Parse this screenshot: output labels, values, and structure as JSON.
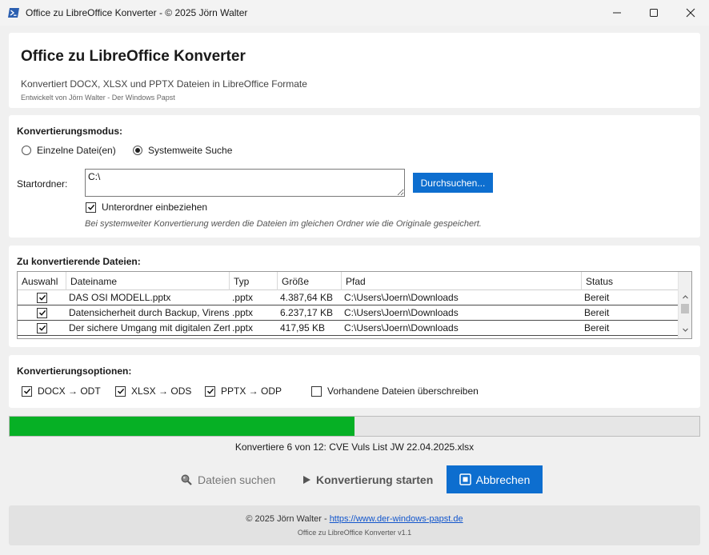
{
  "window": {
    "title": "Office zu LibreOffice Konverter - © 2025 Jörn Walter",
    "icon": "powershell-icon",
    "controls": [
      "minimize-icon",
      "maximize-icon",
      "close-icon"
    ]
  },
  "header": {
    "title": "Office zu LibreOffice Konverter",
    "subtitle": "Konvertiert DOCX, XLSX und PPTX Dateien in LibreOffice Formate",
    "developer": "Entwickelt von Jörn Walter - Der Windows Papst"
  },
  "mode": {
    "section_title": "Konvertierungsmodus:",
    "option_single": "Einzelne Datei(en)",
    "option_system": "Systemweite Suche",
    "selected": "system",
    "start_folder_label": "Startordner:",
    "start_folder_value": "C:\\",
    "browse_label": "Durchsuchen...",
    "include_subfolders_label": "Unterordner einbeziehen",
    "include_subfolders_checked": true,
    "hint": "Bei systemweiter Konvertierung werden die Dateien im gleichen Ordner wie die Originale gespeichert."
  },
  "files": {
    "section_title": "Zu konvertierende Dateien:",
    "columns": [
      "Auswahl",
      "Dateiname",
      "Typ",
      "Größe",
      "Pfad",
      "Status"
    ],
    "rows": [
      {
        "selected": true,
        "name": "DAS OSI MODELL.pptx",
        "type": ".pptx",
        "size": "4.387,64 KB",
        "path": "C:\\Users\\Joern\\Downloads",
        "status": "Bereit"
      },
      {
        "selected": true,
        "name": "Datensicherheit durch Backup, Virenscanner.pptx",
        "type": ".pptx",
        "size": "6.237,17 KB",
        "path": "C:\\Users\\Joern\\Downloads",
        "status": "Bereit"
      },
      {
        "selected": true,
        "name": "Der sichere Umgang mit digitalen Zertifikaten.pptx",
        "type": ".pptx",
        "size": "417,95 KB",
        "path": "C:\\Users\\Joern\\Downloads",
        "status": "Bereit"
      }
    ]
  },
  "options": {
    "section_title": "Konvertierungsoptionen:",
    "docx_label": "DOCX → ODT",
    "docx_checked": true,
    "xlsx_label": "XLSX → ODS",
    "xlsx_checked": true,
    "pptx_label": "PPTX → ODP",
    "pptx_checked": true,
    "overwrite_label": "Vorhandene Dateien überschreiben",
    "overwrite_checked": false
  },
  "progress": {
    "fraction": 0.5,
    "status_text": "Konvertiere 6 von 12: CVE Vuls List JW 22.04.2025.xlsx"
  },
  "actions": {
    "search_label": "Dateien suchen",
    "start_label": "Konvertierung starten",
    "cancel_label": "Abbrechen"
  },
  "footer": {
    "copyright": "© 2025 Jörn Walter - ",
    "link_text": "https://www.der-windows-papst.de",
    "version": "Office zu LibreOffice Konverter v1.1"
  },
  "colors": {
    "accent": "#0d6ecf",
    "progress_fill": "#06b025"
  }
}
